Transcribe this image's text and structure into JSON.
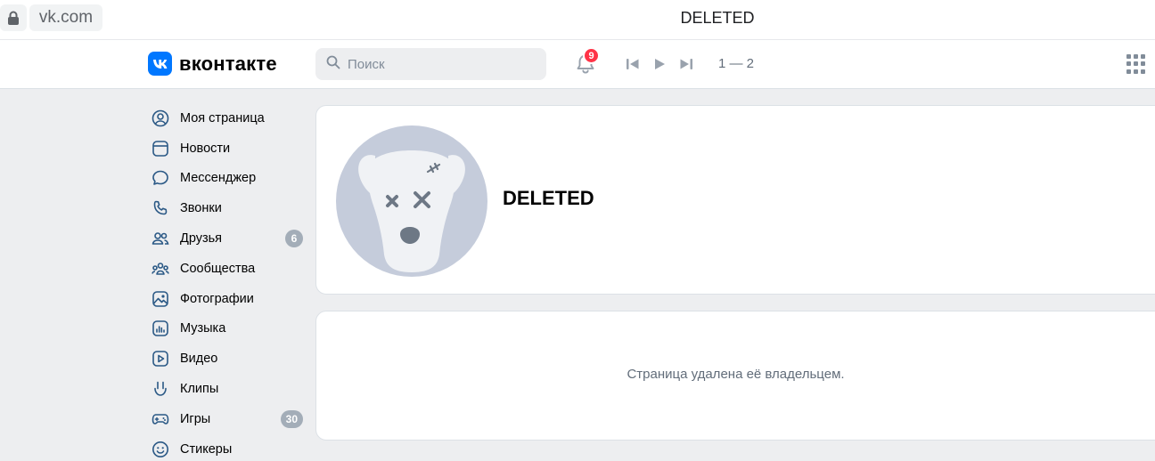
{
  "browser": {
    "url": "vk.com",
    "tab_title": "DELETED"
  },
  "header": {
    "logo_text": "вконтакте",
    "search_placeholder": "Поиск",
    "notifications_count": "9",
    "player_track": "1 — 2"
  },
  "sidebar": {
    "items": [
      {
        "label": "Моя страница",
        "icon": "user-circle-icon"
      },
      {
        "label": "Новости",
        "icon": "newsfeed-icon"
      },
      {
        "label": "Мессенджер",
        "icon": "message-icon"
      },
      {
        "label": "Звонки",
        "icon": "phone-icon"
      },
      {
        "label": "Друзья",
        "icon": "friends-icon",
        "badge": "6"
      },
      {
        "label": "Сообщества",
        "icon": "communities-icon"
      },
      {
        "label": "Фотографии",
        "icon": "photo-icon"
      },
      {
        "label": "Музыка",
        "icon": "music-icon"
      },
      {
        "label": "Видео",
        "icon": "video-icon"
      },
      {
        "label": "Клипы",
        "icon": "clips-icon"
      },
      {
        "label": "Игры",
        "icon": "games-icon",
        "badge": "30"
      },
      {
        "label": "Стикеры",
        "icon": "stickers-icon"
      }
    ]
  },
  "profile": {
    "name": "DELETED",
    "status_message": "Страница удалена её владельцем."
  },
  "colors": {
    "accent": "#0077ff",
    "badge_red": "#ff3347",
    "icon_blue": "#2a5885",
    "page_bg": "#edeef0"
  }
}
